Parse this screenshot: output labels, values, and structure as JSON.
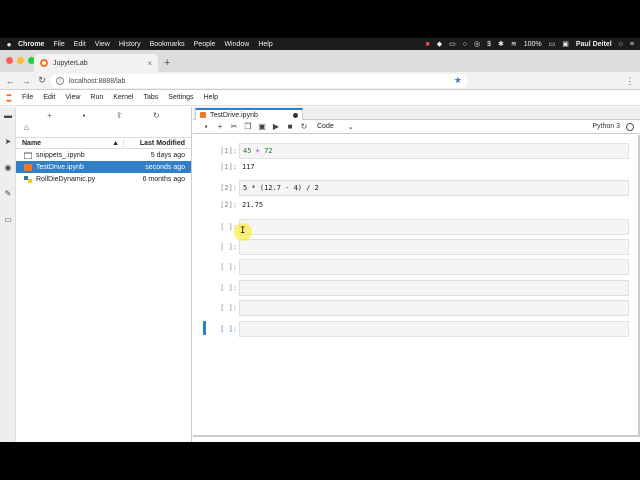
{
  "mac_menubar": {
    "apple": "",
    "items": [
      "Chrome",
      "File",
      "Edit",
      "View",
      "History",
      "Bookmarks",
      "People",
      "Window",
      "Help"
    ],
    "battery": "100%",
    "user": "Paul Deitel"
  },
  "browser": {
    "tab_title": "JupyterLab",
    "tab_close": "×",
    "new_tab": "+",
    "url": "localhost:8888/lab",
    "colors": {
      "close": "#fd5f57",
      "minimize": "#fdbb2e",
      "zoom": "#2ac940"
    }
  },
  "jupyter_menu": [
    "File",
    "Edit",
    "View",
    "Run",
    "Kernel",
    "Tabs",
    "Settings",
    "Help"
  ],
  "file_browser": {
    "columns": {
      "name": "Name",
      "modified": "Last Modified",
      "sort_indicator": "▲"
    },
    "files": [
      {
        "name": "snippets_.ipynb",
        "modified": "5 days ago",
        "icon": "folder-icon"
      },
      {
        "name": "TestDrive.ipynb",
        "modified": "seconds ago",
        "icon": "notebook-icon",
        "selected": true
      },
      {
        "name": "RollDieDynamic.py",
        "modified": "6 months ago",
        "icon": "python-file-icon"
      }
    ]
  },
  "notebook": {
    "tab_name": "TestDrive.ipynb",
    "cell_type": "Code",
    "kernel": "Python 3",
    "cells": [
      {
        "in_prompt": "[1]:",
        "code_a": "45",
        "code_op": "+",
        "code_b": "72",
        "out_prompt": "[1]:",
        "output": "117"
      },
      {
        "in_prompt": "[2]:",
        "code": "5 * (12.7 - 4) / 2",
        "out_prompt": "[2]:",
        "output": "21.75"
      }
    ],
    "empty_prompt": "[ ]:",
    "empty_count": 6
  }
}
